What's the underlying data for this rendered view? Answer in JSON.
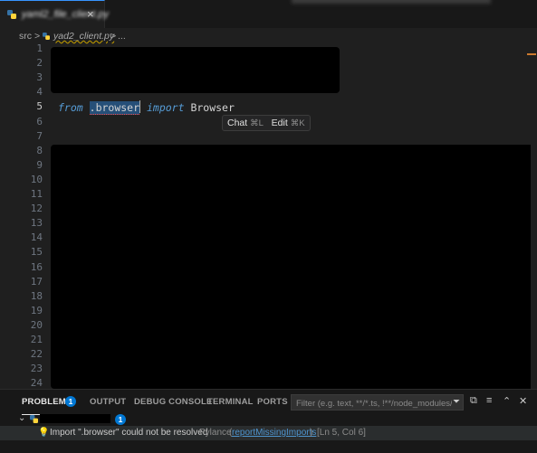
{
  "tab": {
    "label": "yaml2_file_client.py",
    "close_glyph": "×"
  },
  "breadcrumb": {
    "root": "src",
    "sep1": ">",
    "file": "yad2_client.py",
    "sep2": ">",
    "rest": "..."
  },
  "editor": {
    "line_numbers": [
      "1",
      "2",
      "3",
      "4",
      "5",
      "6",
      "7",
      "8",
      "9",
      "10",
      "11",
      "12",
      "13",
      "14",
      "15",
      "16",
      "17",
      "18",
      "19",
      "20",
      "21",
      "22",
      "23",
      "24"
    ],
    "active_line": "5",
    "line5": {
      "kw_from": "from",
      "space1": " ",
      "module": ".browser",
      "kw_import": "import",
      "name": " Browser"
    },
    "hint": {
      "chat": "Chat",
      "chat_key": "⌘L",
      "edit": "Edit",
      "edit_key": "⌘K"
    }
  },
  "panel": {
    "tabs": {
      "problems": "PROBLEMS",
      "output": "OUTPUT",
      "debug": "DEBUG CONSOLE",
      "terminal": "TERMINAL",
      "ports": "PORTS"
    },
    "problems_count": "1",
    "filter_placeholder": "Filter (e.g. text, **/*.ts, !**/node_modules/**)",
    "file_count": "1",
    "issue": {
      "message": "Import \".browser\" could not be resolved",
      "source": "Pylance",
      "code_open": "(",
      "code": "reportMissingImports",
      "code_close": ")",
      "position": "[Ln 5, Col 6]"
    }
  },
  "colors": {
    "accent": "#0078d4",
    "keyword": "#569cd6",
    "link": "#4e94ce",
    "background": "#1f1f1f"
  }
}
